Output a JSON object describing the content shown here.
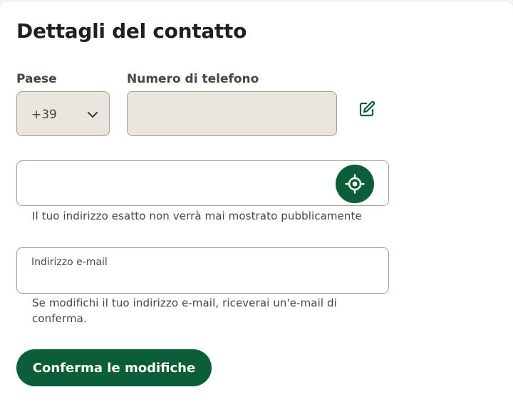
{
  "page": {
    "title": "Dettagli del contatto"
  },
  "phone": {
    "country_label": "Paese",
    "country_value": "+39",
    "number_label": "Numero di telefono",
    "number_value": "",
    "edit_icon": "edit-pencil-icon"
  },
  "address": {
    "value": "",
    "locate_icon": "crosshair-icon",
    "helper": "Il tuo indirizzo esatto non verrà mai mostrato pubblicamente"
  },
  "email": {
    "label": "Indirizzo e-mail",
    "value": "",
    "helper": "Se modifichi il tuo indirizzo e-mail, riceverai un'e-mail di conferma."
  },
  "actions": {
    "confirm_label": "Conferma le modifiche"
  },
  "colors": {
    "primary": "#0b5e38",
    "input_disabled_bg": "#eae5de",
    "input_border": "#a79f88",
    "text_muted": "#4a4540"
  }
}
